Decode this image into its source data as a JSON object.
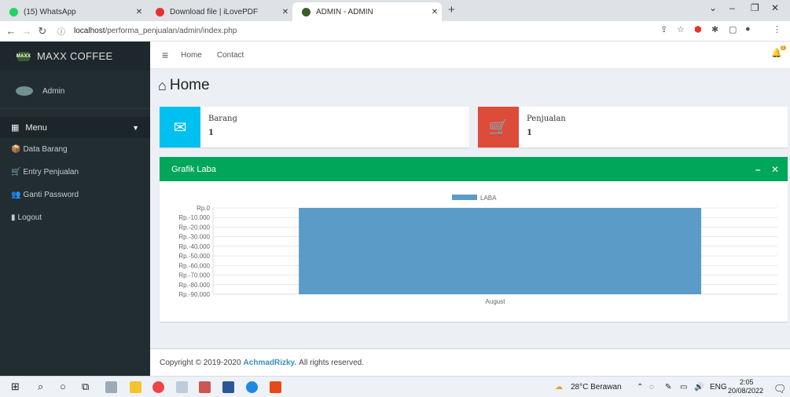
{
  "browser": {
    "tabs": [
      {
        "title": "(15) WhatsApp",
        "favicon_color": "#25d366"
      },
      {
        "title": "Download file | iLovePDF",
        "favicon_color": "#e5322d"
      },
      {
        "title": "ADMIN - ADMIN",
        "favicon_color": "#3a5d2a"
      }
    ],
    "url_host": "localhost",
    "url_path": "/performa_penjualan/admin/index.php"
  },
  "sidebar": {
    "brand": "MAXX COFFEE",
    "brand_badge": "MAXX",
    "user": "Admin",
    "menu_header": "Menu",
    "items": [
      {
        "label": "Data Barang",
        "icon": "boxes-icon"
      },
      {
        "label": "Entry Penjualan",
        "icon": "cart-icon"
      },
      {
        "label": "Ganti Password",
        "icon": "users-icon"
      },
      {
        "label": "Logout",
        "icon": "logout-icon"
      }
    ]
  },
  "topnav": {
    "links": [
      "Home",
      "Contact"
    ],
    "notification_count": "1"
  },
  "page": {
    "title": "Home",
    "cards": [
      {
        "label": "Barang",
        "value": "1",
        "color": "#00c0ef"
      },
      {
        "label": "Penjualan",
        "value": "1",
        "color": "#dd4b39"
      }
    ],
    "chart_panel_title": "Grafik Laba"
  },
  "chart_data": {
    "type": "bar",
    "categories": [
      "August"
    ],
    "series": [
      {
        "name": "LABA",
        "values": [
          -96000
        ],
        "color": "#5b9bc8"
      }
    ],
    "yticks": [
      "Rp.0",
      "Rp.-10.000",
      "Rp.-20.000",
      "Rp.-30.000",
      "Rp.-40.000",
      "Rp.-50.000",
      "Rp.-60.000",
      "Rp.-70.000",
      "Rp.-80.000",
      "Rp.-90.000"
    ],
    "ylim": [
      -90000,
      0
    ],
    "legend": "top-center",
    "grid": true
  },
  "footer": {
    "prefix": "Copyright © 2019-2020",
    "author": "AchmadRizky.",
    "suffix": "All rights reserved."
  },
  "taskbar": {
    "weather": "28°C Berawan",
    "lang": "ENG",
    "time": "2:05",
    "date": "20/08/2022"
  }
}
